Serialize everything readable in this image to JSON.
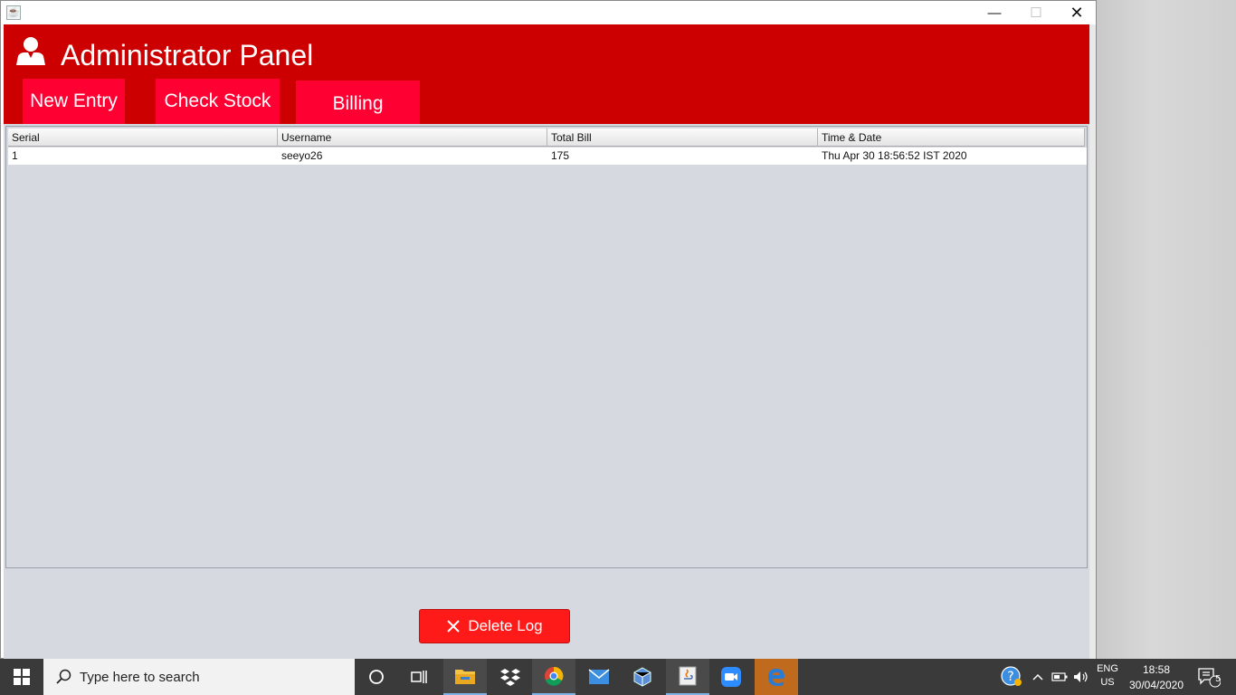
{
  "window": {
    "minimize_glyph": "—",
    "maximize_glyph": "☐",
    "close_glyph": "✕"
  },
  "header": {
    "title": "Administrator Panel",
    "icon": "user-icon"
  },
  "nav": {
    "new_entry": "New Entry",
    "check_stock": "Check Stock",
    "billing": "Billing"
  },
  "table": {
    "columns": [
      "Serial",
      "Username",
      "Total Bill",
      "Time & Date"
    ],
    "rows": [
      [
        "1",
        "seeyo26",
        "175",
        "Thu Apr 30 18:56:52 IST 2020"
      ]
    ]
  },
  "actions": {
    "delete_log": "Delete Log"
  },
  "taskbar": {
    "search_placeholder": "Type here to search",
    "lang_line1": "ENG",
    "lang_line2": "US",
    "time": "18:58",
    "date": "30/04/2020",
    "notification_count": "5"
  },
  "colors": {
    "header_bg": "#cc0000",
    "nav_button_bg": "#ff0033",
    "delete_button_bg": "#ff1a1a"
  }
}
